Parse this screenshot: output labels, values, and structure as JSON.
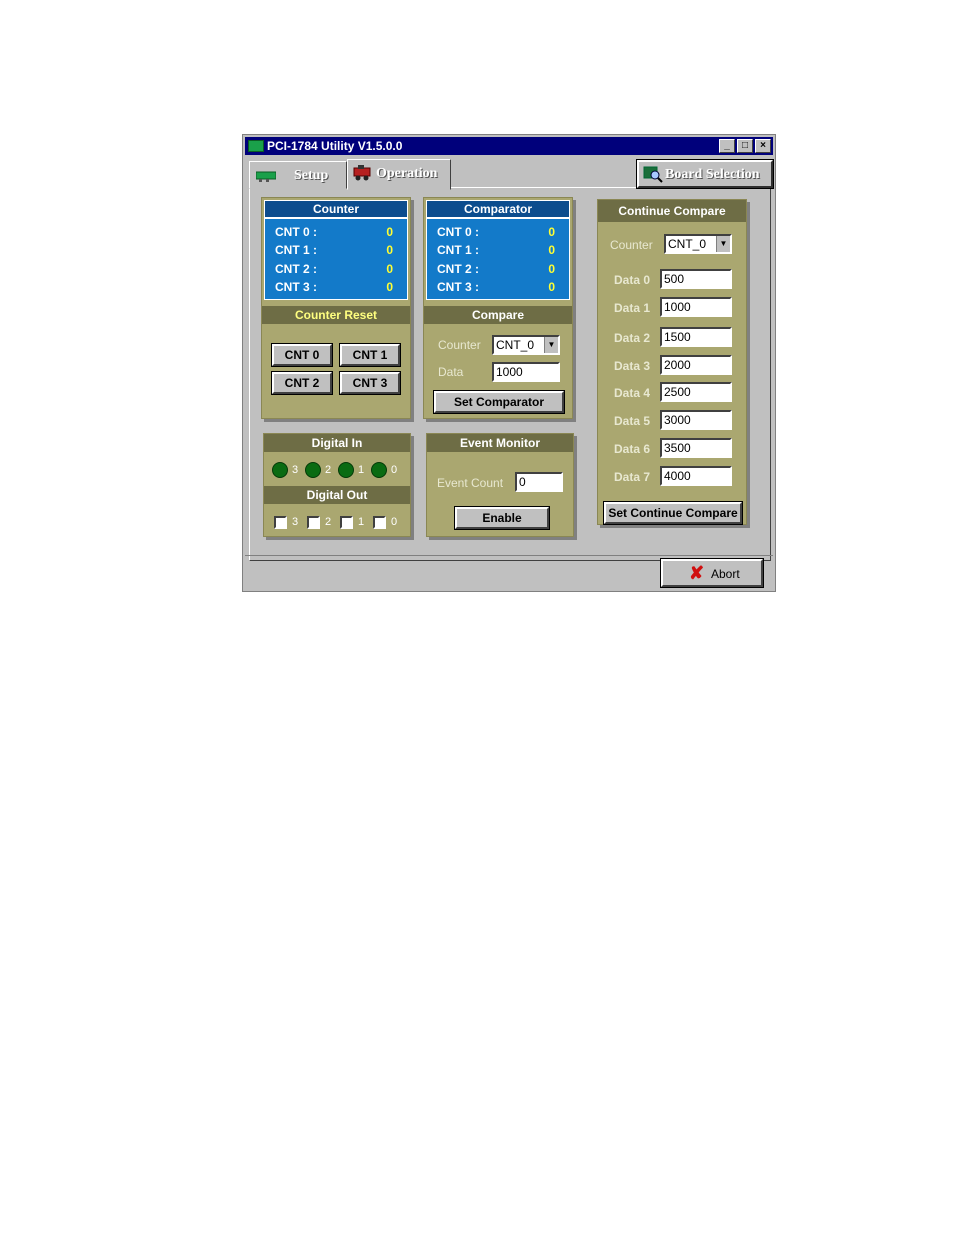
{
  "window": {
    "title": "PCI-1784 Utility V1.5.0.0",
    "controls": {
      "minimize": "_",
      "maximize": "□",
      "close": "×"
    }
  },
  "tabs": [
    {
      "label": "Setup",
      "icon": "board-icon"
    },
    {
      "label": "Operation",
      "icon": "train-icon",
      "active": true
    }
  ],
  "board_selection": {
    "label": "Board Selection",
    "icon": "board-search-icon"
  },
  "counter": {
    "title": "Counter",
    "rows": [
      {
        "name": "CNT 0 :",
        "value": "0"
      },
      {
        "name": "CNT 1 :",
        "value": "0"
      },
      {
        "name": "CNT 2 :",
        "value": "0"
      },
      {
        "name": "CNT 3 :",
        "value": "0"
      }
    ]
  },
  "comparator": {
    "title": "Comparator",
    "rows": [
      {
        "name": "CNT 0 :",
        "value": "0"
      },
      {
        "name": "CNT 1 :",
        "value": "0"
      },
      {
        "name": "CNT 2 :",
        "value": "0"
      },
      {
        "name": "CNT 3 :",
        "value": "0"
      }
    ]
  },
  "counter_reset": {
    "title": "Counter Reset",
    "buttons": [
      "CNT 0",
      "CNT 1",
      "CNT 2",
      "CNT 3"
    ]
  },
  "compare": {
    "title": "Compare",
    "counter_label": "Counter",
    "counter_value": "CNT_0",
    "data_label": "Data",
    "data_value": "1000",
    "set_button": "Set Comparator"
  },
  "continue_compare": {
    "title": "Continue Compare",
    "counter_label": "Counter",
    "counter_value": "CNT_0",
    "data": [
      {
        "label": "Data 0",
        "value": "500"
      },
      {
        "label": "Data 1",
        "value": "1000"
      },
      {
        "label": "Data 2",
        "value": "1500"
      },
      {
        "label": "Data 3",
        "value": "2000"
      },
      {
        "label": "Data 4",
        "value": "2500"
      },
      {
        "label": "Data 5",
        "value": "3000"
      },
      {
        "label": "Data 6",
        "value": "3500"
      },
      {
        "label": "Data 7",
        "value": "4000"
      }
    ],
    "set_button": "Set Continue Compare"
  },
  "digital_in": {
    "title": "Digital In",
    "channels": [
      "3",
      "2",
      "1",
      "0"
    ]
  },
  "digital_out": {
    "title": "Digital Out",
    "channels": [
      "3",
      "2",
      "1",
      "0"
    ]
  },
  "event_monitor": {
    "title": "Event Monitor",
    "count_label": "Event Count",
    "count_value": "0",
    "enable_button": "Enable"
  },
  "abort_button": {
    "label": "Abort",
    "icon": "x-icon"
  },
  "colors": {
    "titlebar": "#00007b",
    "panel": "#aaa770",
    "panel_header": "#6e6d45",
    "counter_bg": "#137ac9",
    "value_text": "#ffff33",
    "led": "#0a6b12"
  }
}
